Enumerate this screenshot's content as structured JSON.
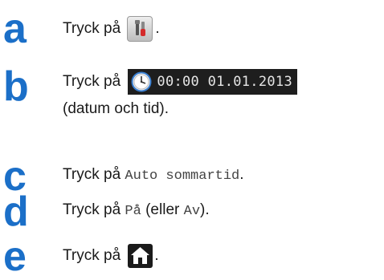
{
  "steps": [
    {
      "letter": "a",
      "prefix": "Tryck på",
      "icon": "tools-icon",
      "suffix": "."
    },
    {
      "letter": "b",
      "prefix": "Tryck på",
      "icon": "clock-icon",
      "datetime": "00:00 01.01.2013",
      "line2": "(datum och tid)."
    },
    {
      "letter": "c",
      "prefix": "Tryck på",
      "option": "Auto sommartid",
      "suffix": "."
    },
    {
      "letter": "d",
      "prefix": "Tryck på",
      "option": "På",
      "middle": "(eller",
      "option2": "Av",
      "suffix": ")."
    },
    {
      "letter": "e",
      "prefix": "Tryck på",
      "icon": "home-icon",
      "suffix": "."
    }
  ],
  "colors": {
    "step_letter": "#1b6fc8",
    "display_bar": "#1e1e1e",
    "home_icon_bg": "#1b1b1b"
  }
}
